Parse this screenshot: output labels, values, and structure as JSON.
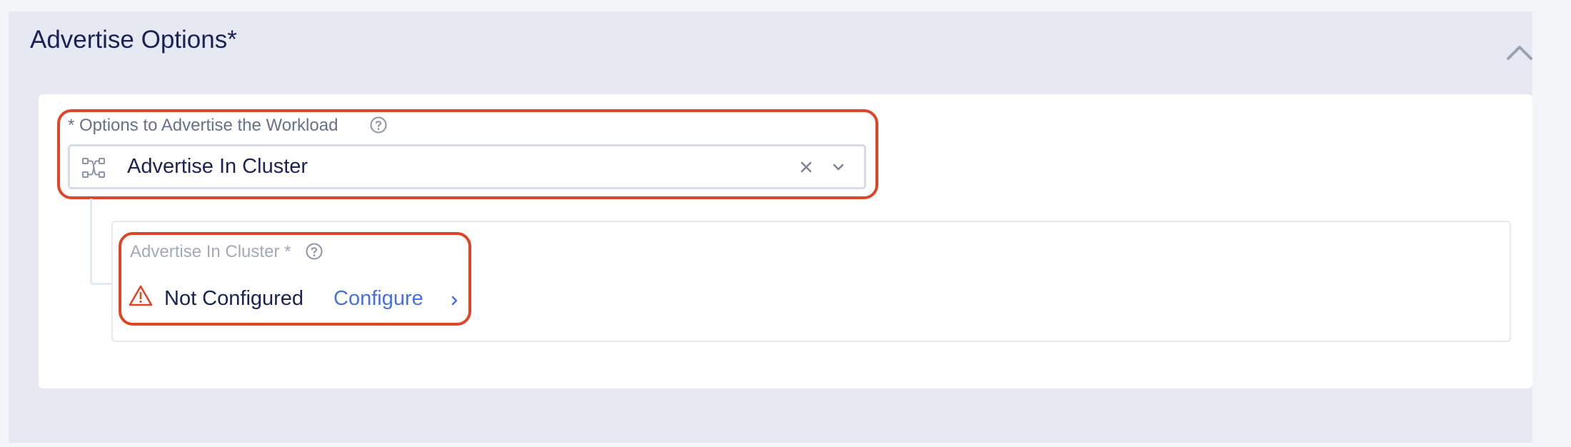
{
  "section": {
    "title": "Advertise Options",
    "required_mark": "*",
    "collapse_icon": "chevron-up-icon"
  },
  "advertise_field": {
    "required_mark": "*",
    "label": "Options to Advertise the Workload",
    "help_icon": "question-circle-icon",
    "select": {
      "icon": "network-route-icon",
      "value": "Advertise In Cluster",
      "clear_icon": "clear-x-icon",
      "dropdown_icon": "chevron-down-icon"
    }
  },
  "advertise_in_cluster": {
    "label": "Advertise In Cluster",
    "required_mark": "*",
    "help_icon": "question-circle-icon",
    "status_icon": "warning-triangle-icon",
    "status": "Not Configured",
    "action_label": "Configure",
    "action_icon": "chevron-right-icon"
  },
  "colors": {
    "highlight": "#e14527",
    "link": "#4670e8",
    "text": "#1b2355",
    "panel_bg": "#e6e9f2"
  }
}
